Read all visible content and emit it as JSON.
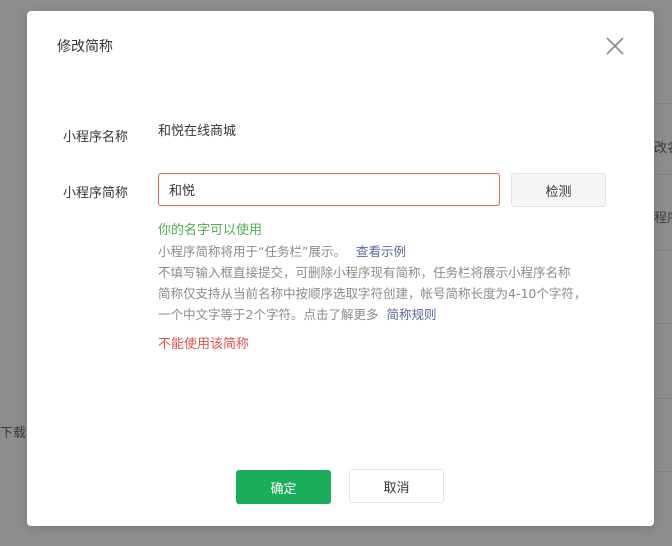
{
  "background": {
    "right_text_1": "改名",
    "right_text_2": "程序",
    "left_text": "下载"
  },
  "modal": {
    "title": "修改简称",
    "close_icon": "close-icon",
    "program_name_label": "小程序名称",
    "program_name_value": "和悦在线商城",
    "short_name_label": "小程序简称",
    "short_name_input_value": "和悦",
    "check_button_label": "检测",
    "success_message": "你的名字可以使用",
    "help_line_1_text": "小程序简称将用于“任务栏”展示。",
    "help_line_1_link": "查看示例",
    "help_line_2": "不填写输入框直接提交，可删除小程序现有简称，任务栏将展示小程序名称",
    "help_line_3": "简称仅支持从当前名称中按顺序选取字符创建，帐号简称长度为4-10个字符，",
    "help_line_4_text": "一个中文字等于2个字符。点击了解更多",
    "help_line_4_link": "简称规则",
    "error_message": "不能使用该简称",
    "confirm_button_label": "确定",
    "cancel_button_label": "取消"
  },
  "colors": {
    "accent_green": "#1aad5c",
    "success_green": "#4caf50",
    "error_red": "#e05050",
    "link_blue": "#56699c"
  }
}
